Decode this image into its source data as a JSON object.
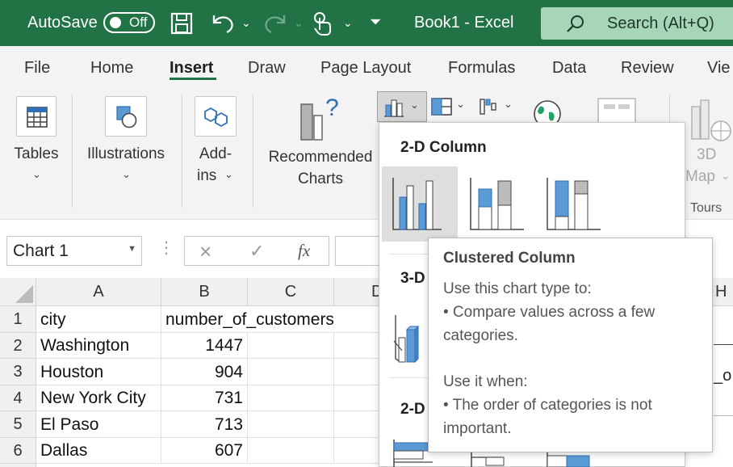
{
  "titlebar": {
    "autosave_label": "AutoSave",
    "autosave_state": "Off",
    "doc_title": "Book1  -  Excel",
    "search_placeholder": "Search (Alt+Q)",
    "bg_color": "#217346"
  },
  "tabs": [
    {
      "label": "File"
    },
    {
      "label": "Home"
    },
    {
      "label": "Insert",
      "active": true
    },
    {
      "label": "Draw"
    },
    {
      "label": "Page Layout"
    },
    {
      "label": "Formulas"
    },
    {
      "label": "Data"
    },
    {
      "label": "Review"
    },
    {
      "label": "Vie"
    }
  ],
  "ribbon": {
    "tables_label": "Tables",
    "illustrations_label": "Illustrations",
    "addins_label_1": "Add-",
    "addins_label_2": "ins",
    "recommended_label_1": "Recommended",
    "recommended_label_2": "Charts",
    "map3d_label_1": "3D",
    "map3d_label_2": "Map",
    "tours_label": "Tours"
  },
  "formula_bar": {
    "name_box": "Chart 1",
    "cancel_icon": "×",
    "enter_icon": "✓",
    "fx_label": "fx"
  },
  "grid": {
    "columns": [
      "A",
      "B",
      "C",
      "D",
      "H"
    ],
    "rows": [
      {
        "num": "1",
        "a": "city",
        "b": "number_of_customers"
      },
      {
        "num": "2",
        "a": "Washington",
        "b": "1447"
      },
      {
        "num": "3",
        "a": "Houston",
        "b": "904"
      },
      {
        "num": "4",
        "a": "New York City",
        "b": "731"
      },
      {
        "num": "5",
        "a": "El Paso",
        "b": "713"
      },
      {
        "num": "6",
        "a": "Dallas",
        "b": "607"
      }
    ],
    "partial_right_text": "_o"
  },
  "chart_dropdown": {
    "section_2d_column": "2-D Column",
    "section_3d_column": "3-D",
    "section_2d_bar": "2-D",
    "accent_color": "#5b9bd5"
  },
  "tooltip": {
    "title": "Clustered Column",
    "line1": "Use this chart type to:",
    "line2": "• Compare values across a few",
    "line3": "categories.",
    "line4": "Use it when:",
    "line5": "• The order of categories is not",
    "line6": "important."
  }
}
